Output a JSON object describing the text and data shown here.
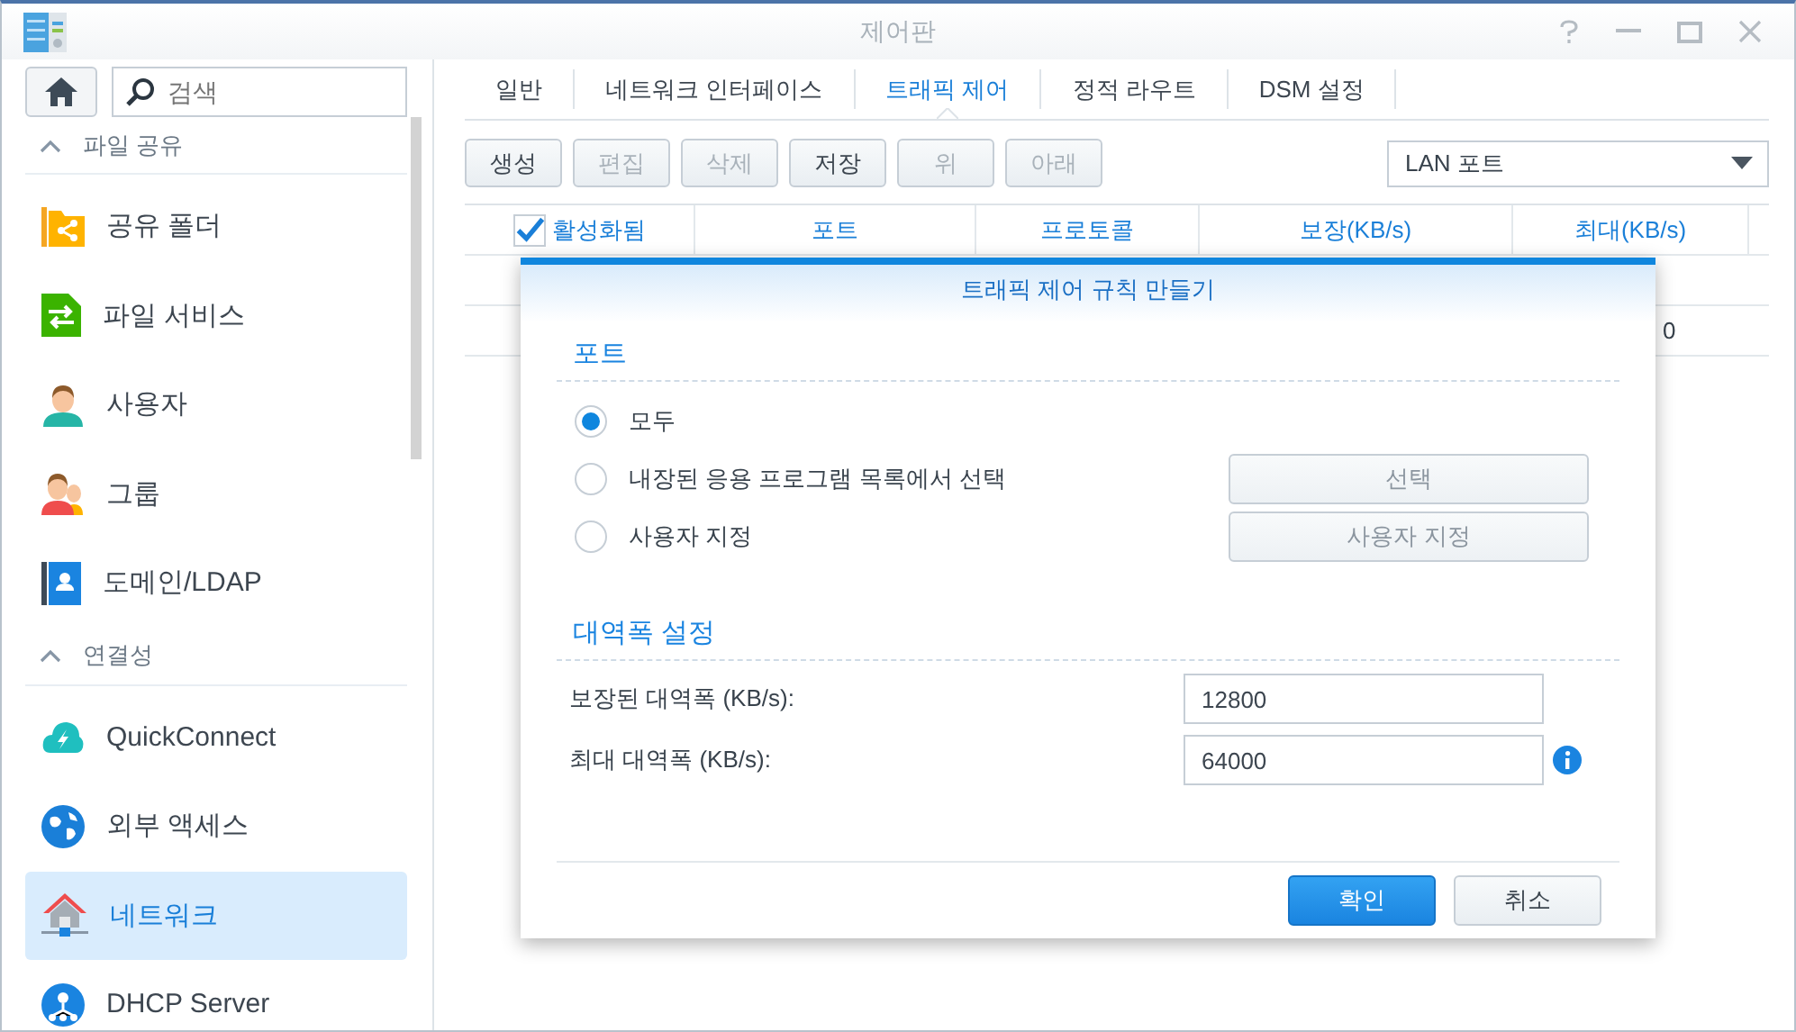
{
  "window": {
    "title": "제어판"
  },
  "search": {
    "placeholder": "검색"
  },
  "sidebar": {
    "sections": [
      {
        "title": "파일 공유",
        "expanded": true,
        "items": [
          {
            "label": "공유 폴더",
            "kind": "folder",
            "selected": false
          },
          {
            "label": "파일 서비스",
            "kind": "file",
            "selected": false
          },
          {
            "label": "사용자",
            "kind": "user",
            "selected": false
          },
          {
            "label": "그룹",
            "kind": "group",
            "selected": false
          },
          {
            "label": "도메인/LDAP",
            "kind": "domain",
            "selected": false
          }
        ]
      },
      {
        "title": "연결성",
        "expanded": true,
        "items": [
          {
            "label": "QuickConnect",
            "kind": "cloud",
            "selected": false
          },
          {
            "label": "외부 액세스",
            "kind": "globe",
            "selected": false
          },
          {
            "label": "네트워크",
            "kind": "house",
            "selected": true
          },
          {
            "label": "DHCP Server",
            "kind": "dhcp",
            "selected": false
          }
        ]
      }
    ]
  },
  "tabs": [
    {
      "label": "일반",
      "selected": false
    },
    {
      "label": "네트워크 인터페이스",
      "selected": false
    },
    {
      "label": "트래픽 제어",
      "selected": true
    },
    {
      "label": "정적 라우트",
      "selected": false
    },
    {
      "label": "DSM 설정",
      "selected": false
    }
  ],
  "toolbar": {
    "buttons": [
      {
        "label": "생성",
        "disabled": false
      },
      {
        "label": "편집",
        "disabled": true
      },
      {
        "label": "삭제",
        "disabled": true
      },
      {
        "label": "저장",
        "disabled": false
      },
      {
        "label": "위",
        "disabled": true
      },
      {
        "label": "아래",
        "disabled": true
      }
    ],
    "port_select": {
      "value": "LAN 포트"
    }
  },
  "table": {
    "columns": [
      {
        "label": "활성화됨",
        "checkbox": true,
        "checked": true
      },
      {
        "label": "포트"
      },
      {
        "label": "프로토콜"
      },
      {
        "label": "보장(KB/s)"
      },
      {
        "label": "최대(KB/s)"
      }
    ],
    "rows": [
      {
        "max": "0"
      }
    ]
  },
  "dialog": {
    "title": "트래픽 제어 규칙 만들기",
    "port": {
      "title": "포트",
      "options": [
        {
          "label": "모두",
          "selected": true
        },
        {
          "label": "내장된 응용 프로그램 목록에서 선택",
          "selected": false,
          "button": {
            "label": "선택",
            "disabled": true
          }
        },
        {
          "label": "사용자 지정",
          "selected": false,
          "button": {
            "label": "사용자 지정",
            "disabled": true
          }
        }
      ]
    },
    "bandwidth": {
      "title": "대역폭 설정",
      "fields": [
        {
          "label": "보장된 대역폭 (KB/s):",
          "value": "12800",
          "info": false
        },
        {
          "label": "최대 대역폭 (KB/s):",
          "value": "64000",
          "info": true
        }
      ]
    },
    "buttons": [
      {
        "label": "확인",
        "kind": "primary"
      },
      {
        "label": "취소",
        "kind": "secondary"
      }
    ]
  }
}
